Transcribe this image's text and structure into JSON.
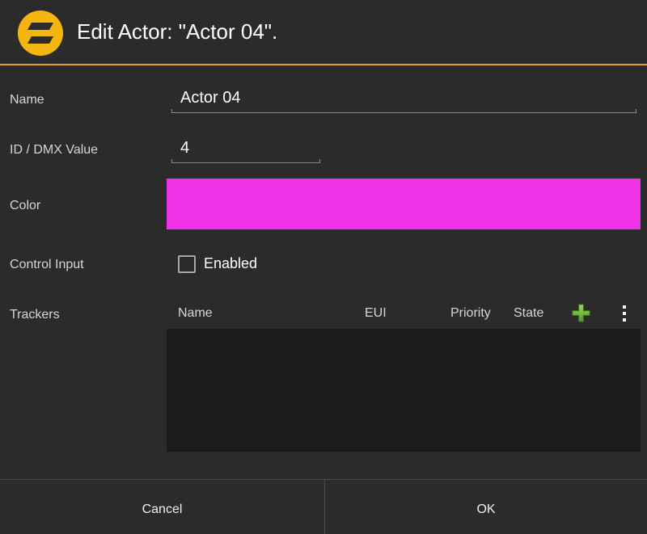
{
  "header": {
    "title": "Edit Actor: \"Actor 04\".",
    "logo_icon": "app-logo-icon"
  },
  "colors": {
    "accent": "#f0a021",
    "logo": "#f5b50f",
    "actor_color": "#f032e6",
    "add_icon": "#7bc043"
  },
  "form": {
    "name_label": "Name",
    "name_value": "Actor 04",
    "id_label": "ID / DMX Value",
    "id_value": "4",
    "color_label": "Color",
    "control_input_label": "Control Input",
    "control_input_checkbox_label": "Enabled",
    "control_input_checked": false,
    "trackers_label": "Trackers"
  },
  "trackers": {
    "columns": [
      "Name",
      "EUI",
      "Priority",
      "State"
    ],
    "add_icon": "plus-icon",
    "menu_icon": "more-vert-icon",
    "rows": []
  },
  "footer": {
    "cancel_label": "Cancel",
    "ok_label": "OK"
  }
}
